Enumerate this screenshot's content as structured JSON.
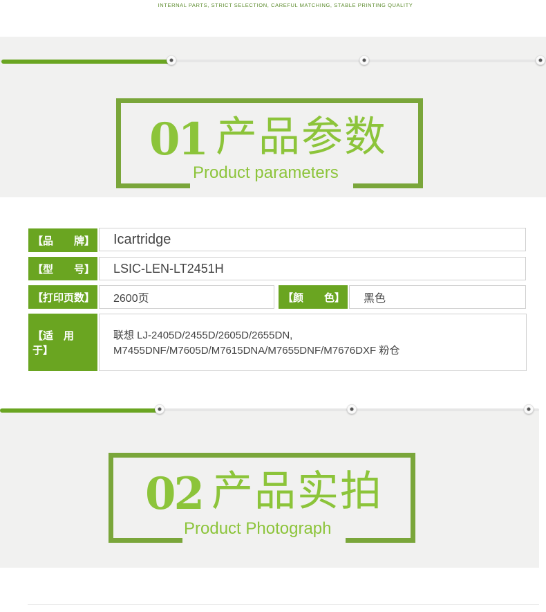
{
  "tagline": "INTERNAL PARTS, STRICT SELECTION, CAREFUL MATCHING, STABLE PRINTING QUALITY",
  "section1": {
    "number": "01",
    "title_cn": "产品参数",
    "title_en": "Product parameters"
  },
  "section2": {
    "number": "02",
    "title_cn": "产品实拍",
    "title_en": "Product Photograph"
  },
  "specs": {
    "brand": {
      "label": "【品　　牌】",
      "value": "Icartridge"
    },
    "model": {
      "label": "【型　　号】",
      "value": "LSIC-LEN-LT2451H"
    },
    "pages": {
      "label": "【打印页数】",
      "value": "2600页"
    },
    "color": {
      "label": "【颜　　色】",
      "value": "黑色"
    },
    "compat": {
      "label": "【适　用　于】",
      "value_line1": "联想 LJ-2405D/2455D/2605D/2655DN,",
      "value_line2": "M7455DNF/M7605D/M7615DNA/M7655DNF/M7676DXF 粉仓"
    }
  },
  "colors": {
    "accent": "#6aa521",
    "heading": "#8cc43a",
    "frame": "#7aa63a",
    "band": "#f1f1f0"
  },
  "progress1": 0.31,
  "progress2": 0.29
}
